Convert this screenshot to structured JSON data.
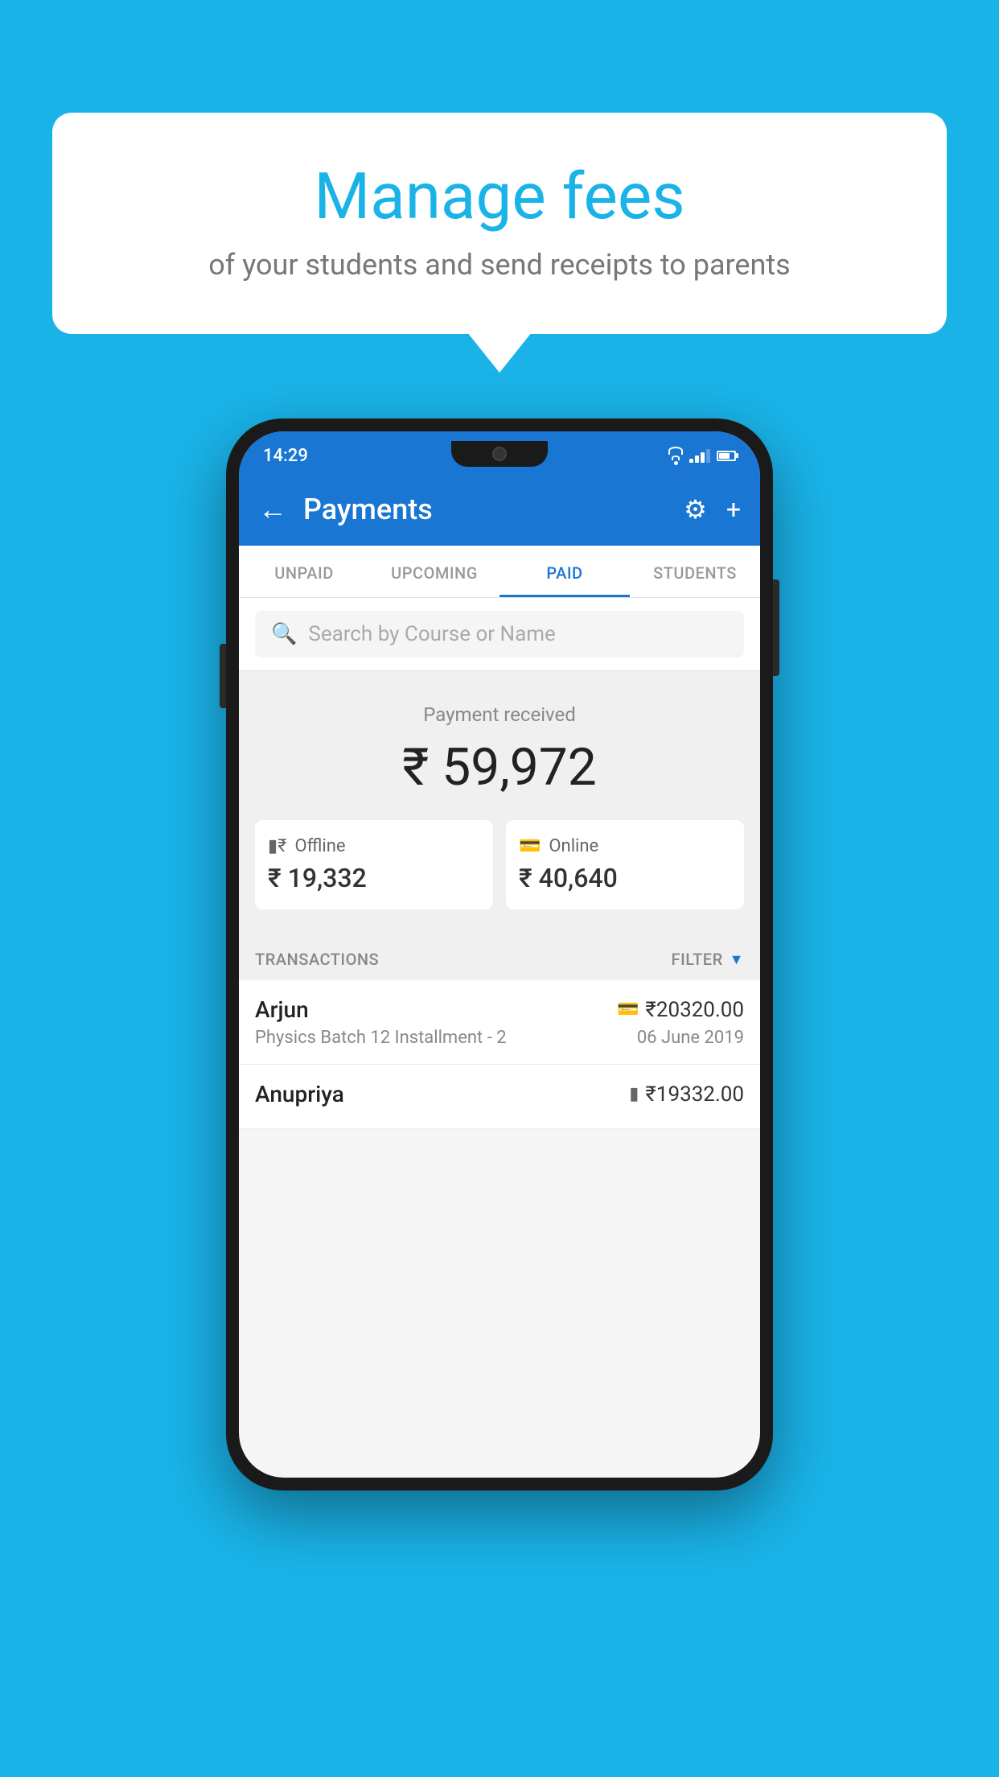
{
  "page": {
    "background_color": "#1ab3e8"
  },
  "bubble": {
    "title": "Manage fees",
    "subtitle": "of your students and send receipts to parents"
  },
  "phone": {
    "status_bar": {
      "time": "14:29"
    },
    "header": {
      "title": "Payments",
      "back_label": "←",
      "settings_label": "⚙",
      "add_label": "+"
    },
    "tabs": [
      {
        "label": "UNPAID",
        "active": false
      },
      {
        "label": "UPCOMING",
        "active": false
      },
      {
        "label": "PAID",
        "active": true
      },
      {
        "label": "STUDENTS",
        "active": false
      }
    ],
    "search": {
      "placeholder": "Search by Course or Name"
    },
    "payment_summary": {
      "label": "Payment received",
      "total": "₹ 59,972",
      "offline_label": "Offline",
      "offline_amount": "₹ 19,332",
      "online_label": "Online",
      "online_amount": "₹ 40,640"
    },
    "transactions": {
      "header_label": "TRANSACTIONS",
      "filter_label": "FILTER",
      "items": [
        {
          "name": "Arjun",
          "course": "Physics Batch 12 Installment - 2",
          "amount": "₹20320.00",
          "date": "06 June 2019",
          "payment_type": "online"
        },
        {
          "name": "Anupriya",
          "course": "",
          "amount": "₹19332.00",
          "date": "",
          "payment_type": "offline"
        }
      ]
    }
  }
}
